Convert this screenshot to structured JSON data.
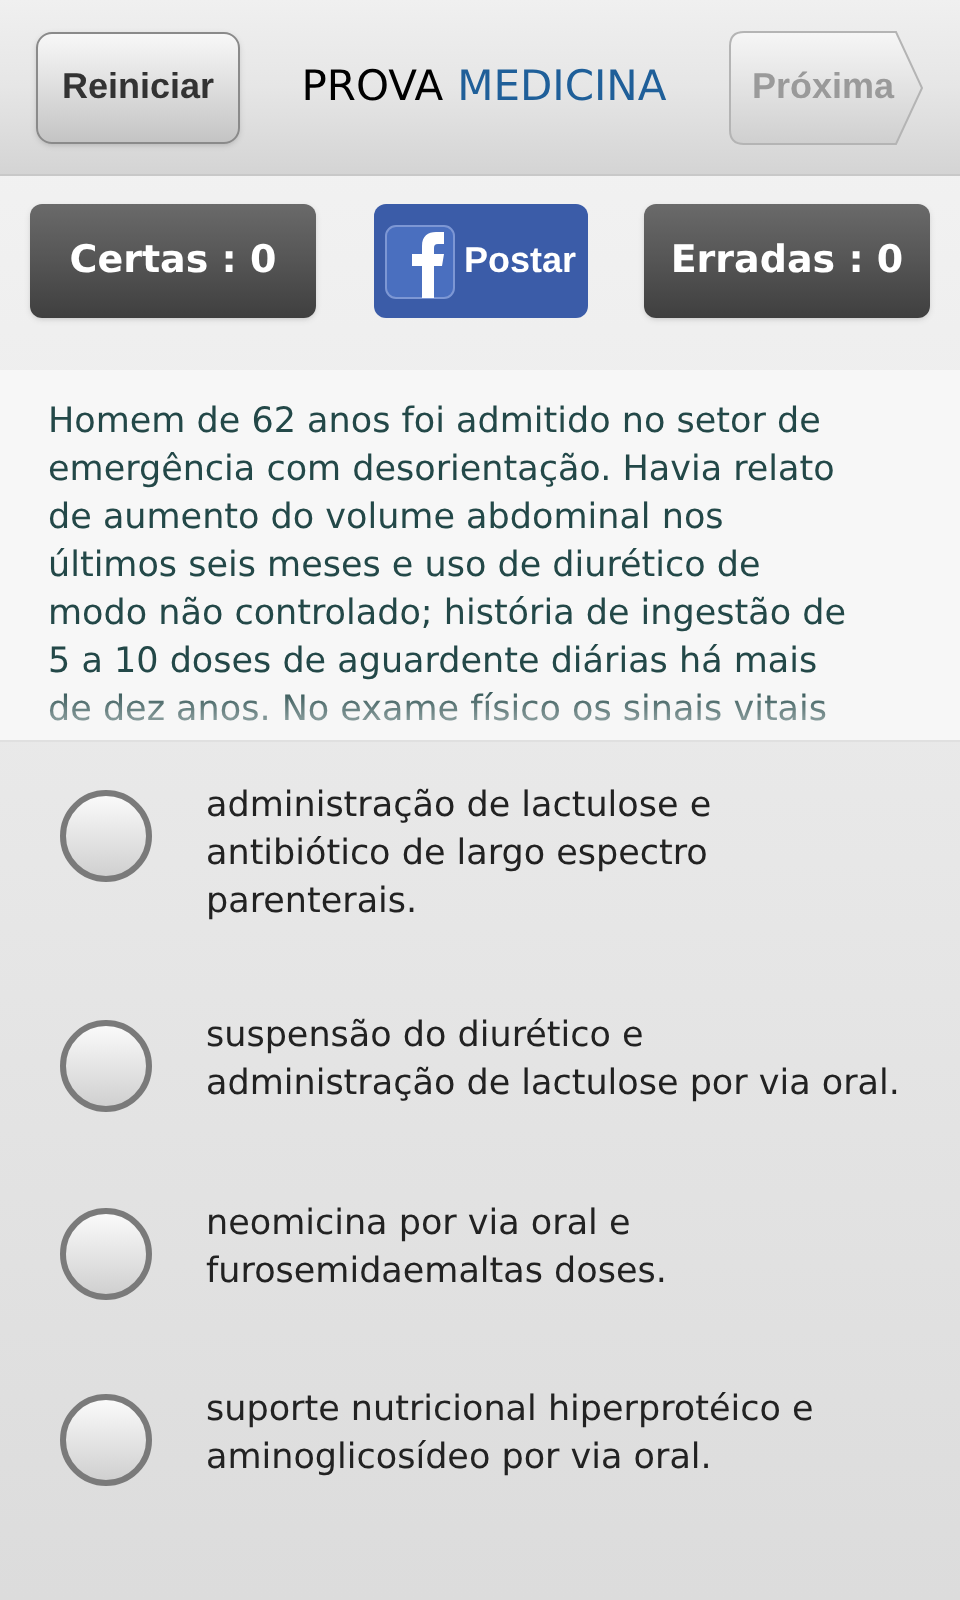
{
  "header": {
    "restart_button": "Reiniciar",
    "title_part_1": "PROVA",
    "title_part_2": "MEDICINA",
    "next_button": {
      "label": "Próxima",
      "disabled": true
    }
  },
  "score": {
    "correct": "Certas : 0",
    "share_button": "Postar",
    "wrong": "Erradas : 0"
  },
  "question": "Homem de 62 anos foi admitido no setor de\nemergência com desorientação. Havia relato\nde aumento do volume abdominal nos\núltimos seis meses e uso de diurético de\nmodo não controlado; história de ingestão de\n5 a 10 doses de aguardente diárias há mais\nde dez anos. No exame físico os sinais vitais",
  "options": [
    {
      "text": "administração de lactulose e\nantibiótico de largo espectro\nparenterais.",
      "selected": false
    },
    {
      "text": "suspensão do diurético e\nadministração de lactulose por via oral.",
      "selected": false
    },
    {
      "text": "neomicina por via oral e\nfurosemidaemaltas doses.",
      "selected": false
    },
    {
      "text": "suporte nutricional hiperprotéico e\naminoglicosídeo por via oral.",
      "selected": false
    }
  ]
}
